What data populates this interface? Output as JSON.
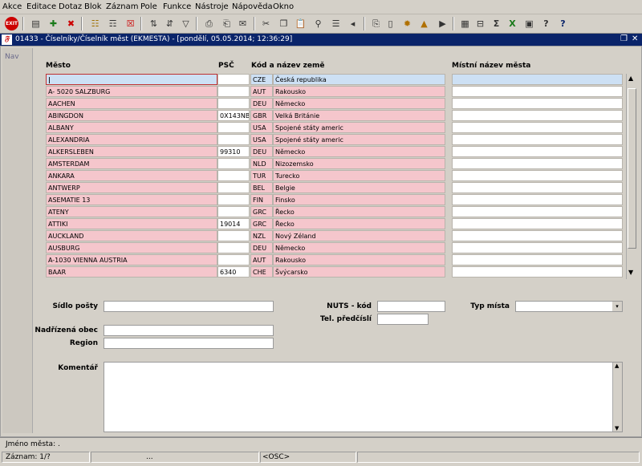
{
  "menu": [
    "Akce",
    "Editace",
    "Dotaz",
    "Blok",
    "Záznam",
    "Pole",
    "Funkce",
    "Nástroje",
    "Nápověda",
    "Okno"
  ],
  "toolbar_icons": [
    "exit-icon",
    "save-icon",
    "new-record-icon",
    "delete-icon",
    "query-icon",
    "execute-query-icon",
    "cancel-query-icon",
    "sort-asc-icon",
    "sort-desc-icon",
    "filter-icon",
    "print-icon",
    "print-setup-icon",
    "email-icon",
    "cut-icon",
    "copy-icon",
    "paste-icon",
    "find-icon",
    "list-icon",
    "prev-icon",
    "next-icon",
    "attach-icon",
    "document-icon",
    "settings-icon",
    "warning-icon",
    "calendar-icon",
    "calc-icon",
    "sum-icon",
    "excel-icon",
    "export-icon",
    "help-query-icon",
    "help-icon"
  ],
  "window": {
    "logo": "𝔉",
    "title": "01433 - Číselníky/Číselník měst (EKMESTA) - [pondělí, 05.05.2014; 12:36:29]"
  },
  "nav": {
    "label": "Nav"
  },
  "grid": {
    "headers": {
      "mesto": "Město",
      "psc": "PSČ",
      "zeme": "Kód a název země",
      "mistni": "Místní název města"
    },
    "rows": [
      {
        "mesto": "",
        "psc": "",
        "kod": "CZE",
        "nazev": "Česká republika"
      },
      {
        "mesto": "A- 5020 SALZBURG",
        "psc": "",
        "kod": "AUT",
        "nazev": "Rakousko"
      },
      {
        "mesto": "AACHEN",
        "psc": "",
        "kod": "DEU",
        "nazev": "Německo"
      },
      {
        "mesto": "ABINGDON",
        "psc": "0X143NB",
        "kod": "GBR",
        "nazev": "Velká Británie"
      },
      {
        "mesto": "ALBANY",
        "psc": "",
        "kod": "USA",
        "nazev": "Spojené státy americ"
      },
      {
        "mesto": "ALEXANDRIA",
        "psc": "",
        "kod": "USA",
        "nazev": "Spojené státy americ"
      },
      {
        "mesto": "ALKERSLEBEN",
        "psc": "99310",
        "kod": "DEU",
        "nazev": "Německo"
      },
      {
        "mesto": "AMSTERDAM",
        "psc": "",
        "kod": "NLD",
        "nazev": "Nizozemsko"
      },
      {
        "mesto": "ANKARA",
        "psc": "",
        "kod": "TUR",
        "nazev": "Turecko"
      },
      {
        "mesto": "ANTWERP",
        "psc": "",
        "kod": "BEL",
        "nazev": "Belgie"
      },
      {
        "mesto": "ASEMATIE 13",
        "psc": "",
        "kod": "FIN",
        "nazev": "Finsko"
      },
      {
        "mesto": "ATENY",
        "psc": "",
        "kod": "GRC",
        "nazev": "Řecko"
      },
      {
        "mesto": "ATTIKI",
        "psc": "19014",
        "kod": "GRC",
        "nazev": "Řecko"
      },
      {
        "mesto": "AUCKLAND",
        "psc": "",
        "kod": "NZL",
        "nazev": "Nový Zéland"
      },
      {
        "mesto": "AUSBURG",
        "psc": "",
        "kod": "DEU",
        "nazev": "Německo"
      },
      {
        "mesto": "A-1030 VIENNA AUSTRIA",
        "psc": "",
        "kod": "AUT",
        "nazev": "Rakousko"
      },
      {
        "mesto": "BAAR",
        "psc": "6340",
        "kod": "CHE",
        "nazev": "Švýcarsko"
      }
    ]
  },
  "form": {
    "sidlo_posty": "Sídlo pošty",
    "nadrizena_obec": "Nadřízená obec",
    "region": "Region",
    "nuts": "NUTS - kód",
    "tel": "Tel. předčíslí",
    "typ_mista": "Typ místa",
    "komentar": "Komentář"
  },
  "status": {
    "line1": "Jméno města: .",
    "record": "Záznam: 1/?",
    "dots": "...",
    "osc": "<OSC>"
  },
  "colors": {
    "pink": "#f5c6cc",
    "current_row": "#cde0f4",
    "title_bar": "#0a246a"
  }
}
